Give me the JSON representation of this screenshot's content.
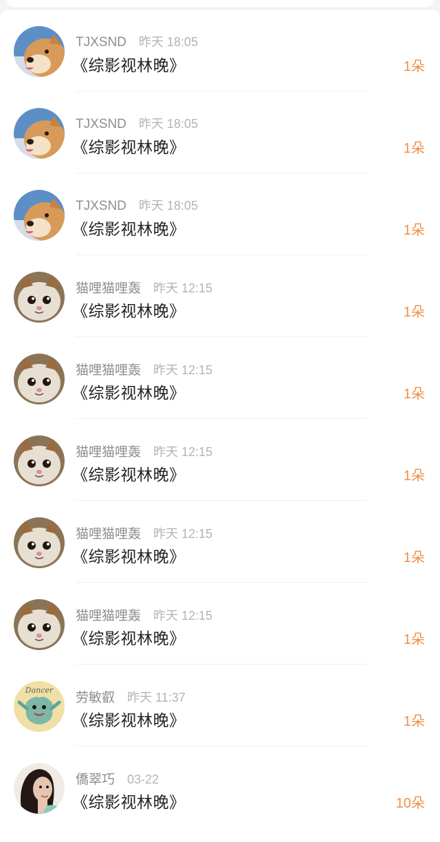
{
  "gifts": [
    {
      "user": "TJXSND",
      "time": "昨天 18:05",
      "message": "《综影视林晚》",
      "amount": "1朵",
      "avatar": "shiba-dog-avatar"
    },
    {
      "user": "TJXSND",
      "time": "昨天 18:05",
      "message": "《综影视林晚》",
      "amount": "1朵",
      "avatar": "shiba-dog-avatar"
    },
    {
      "user": "TJXSND",
      "time": "昨天 18:05",
      "message": "《综影视林晚》",
      "amount": "1朵",
      "avatar": "shiba-dog-avatar"
    },
    {
      "user": "猫哩猫哩轰",
      "time": "昨天 12:15",
      "message": "《综影视林晚》",
      "amount": "1朵",
      "avatar": "cat-avatar"
    },
    {
      "user": "猫哩猫哩轰",
      "time": "昨天 12:15",
      "message": "《综影视林晚》",
      "amount": "1朵",
      "avatar": "cat-avatar"
    },
    {
      "user": "猫哩猫哩轰",
      "time": "昨天 12:15",
      "message": "《综影视林晚》",
      "amount": "1朵",
      "avatar": "cat-avatar"
    },
    {
      "user": "猫哩猫哩轰",
      "time": "昨天 12:15",
      "message": "《综影视林晚》",
      "amount": "1朵",
      "avatar": "cat-avatar"
    },
    {
      "user": "猫哩猫哩轰",
      "time": "昨天 12:15",
      "message": "《综影视林晚》",
      "amount": "1朵",
      "avatar": "cat-avatar"
    },
    {
      "user": "劳敏叡",
      "time": "昨天 11:37",
      "message": "《综影视林晚》",
      "amount": "1朵",
      "avatar": "dancer-cartoon-avatar",
      "avatar_text": "Dancer"
    },
    {
      "user": "僑翠巧",
      "time": "03-22",
      "message": "《综影视林晚》",
      "amount": "10朵",
      "avatar": "woman-photo-avatar"
    }
  ],
  "colors": {
    "amount": "#ef8f47",
    "username": "#8e8e8e",
    "timestamp": "#b3b3b3",
    "message": "#222222"
  }
}
